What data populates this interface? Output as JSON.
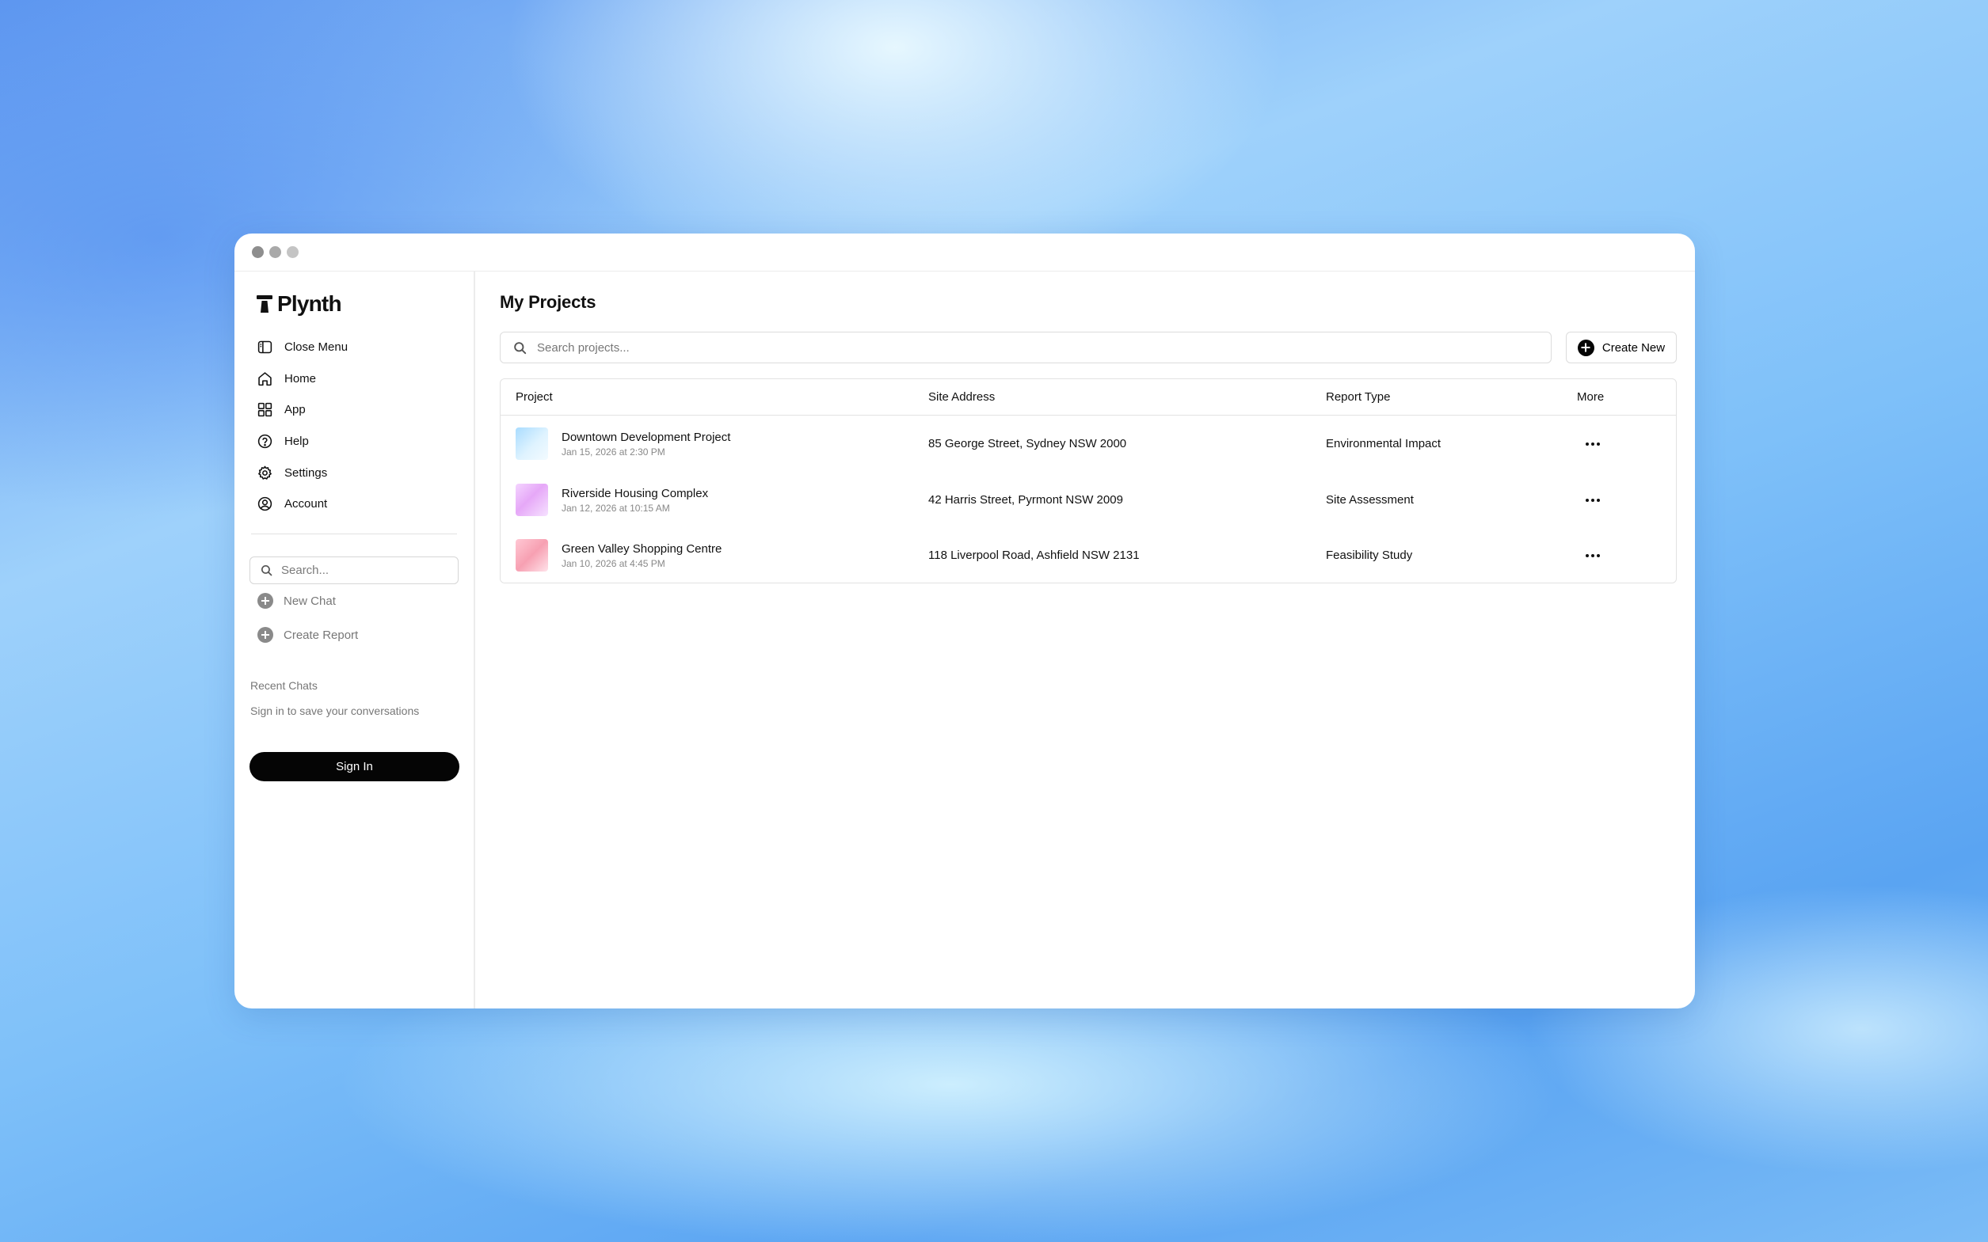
{
  "app": {
    "brand": "Plynth",
    "window_controls": [
      "close",
      "minimize",
      "maximize"
    ]
  },
  "sidebar": {
    "nav": [
      {
        "label": "Close Menu",
        "icon": "sidebar-panel-icon"
      },
      {
        "label": "Home",
        "icon": "home-icon"
      },
      {
        "label": "App",
        "icon": "grid-icon"
      },
      {
        "label": "Help",
        "icon": "question-circle-icon"
      },
      {
        "label": "Settings",
        "icon": "gear-icon"
      },
      {
        "label": "Account",
        "icon": "user-circle-icon"
      }
    ],
    "search_placeholder": "Search...",
    "actions": [
      {
        "label": "New Chat",
        "icon": "plus-circle-icon"
      },
      {
        "label": "Create Report",
        "icon": "plus-circle-icon"
      }
    ],
    "recent_title": "Recent Chats",
    "recent_note": "Sign in to save your conversations",
    "sign_in_label": "Sign In"
  },
  "main": {
    "title": "My Projects",
    "search_placeholder": "Search projects...",
    "create_label": "Create New",
    "table": {
      "headers": [
        "Project",
        "Site Address",
        "Report Type",
        "More"
      ],
      "rows": [
        {
          "name": "Downtown Development Project",
          "date": "Jan 15, 2026 at 2:30 PM",
          "address": "85 George Street, Sydney NSW 2000",
          "report_type": "Environmental Impact"
        },
        {
          "name": "Riverside Housing Complex",
          "date": "Jan 12, 2026 at 10:15 AM",
          "address": "42 Harris Street, Pyrmont NSW 2009",
          "report_type": "Site Assessment"
        },
        {
          "name": "Green Valley Shopping Centre",
          "date": "Jan 10, 2026 at 4:45 PM",
          "address": "118 Liverpool Road, Ashfield NSW 2131",
          "report_type": "Feasibility Study"
        }
      ]
    }
  },
  "colors": {
    "accent": "#050505",
    "muted_text": "#777777",
    "border": "#e2e2e2"
  }
}
